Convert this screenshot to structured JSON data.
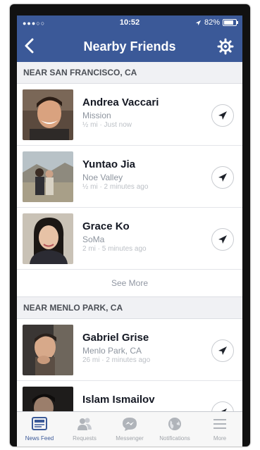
{
  "status": {
    "time": "10:52",
    "battery": "82%",
    "battery_level": 0.82
  },
  "nav": {
    "title": "Nearby Friends"
  },
  "sections": [
    {
      "header": "NEAR SAN FRANCISCO, CA",
      "friends": [
        {
          "name": "Andrea Vaccari",
          "location": "Mission",
          "meta": "½ mi · Just now"
        },
        {
          "name": "Yuntao Jia",
          "location": "Noe Valley",
          "meta": "½ mi · 2 minutes ago"
        },
        {
          "name": "Grace Ko",
          "location": "SoMa",
          "meta": "2 mi · 5 minutes ago"
        }
      ],
      "see_more": "See More"
    },
    {
      "header": "NEAR MENLO PARK, CA",
      "friends": [
        {
          "name": "Gabriel Grise",
          "location": "Menlo Park, CA",
          "meta": "26 mi · 2 minutes ago"
        },
        {
          "name": "Islam Ismailov",
          "location": "",
          "meta": ""
        }
      ]
    }
  ],
  "tabs": [
    {
      "label": "News Feed",
      "icon": "news-feed-icon",
      "active": true
    },
    {
      "label": "Requests",
      "icon": "friend-requests-icon",
      "active": false
    },
    {
      "label": "Messenger",
      "icon": "messenger-icon",
      "active": false
    },
    {
      "label": "Notifications",
      "icon": "globe-icon",
      "active": false
    },
    {
      "label": "More",
      "icon": "menu-icon",
      "active": false
    }
  ],
  "colors": {
    "brand": "#3b5998",
    "accent_active": "#3b5998",
    "muted": "#8d949e"
  }
}
